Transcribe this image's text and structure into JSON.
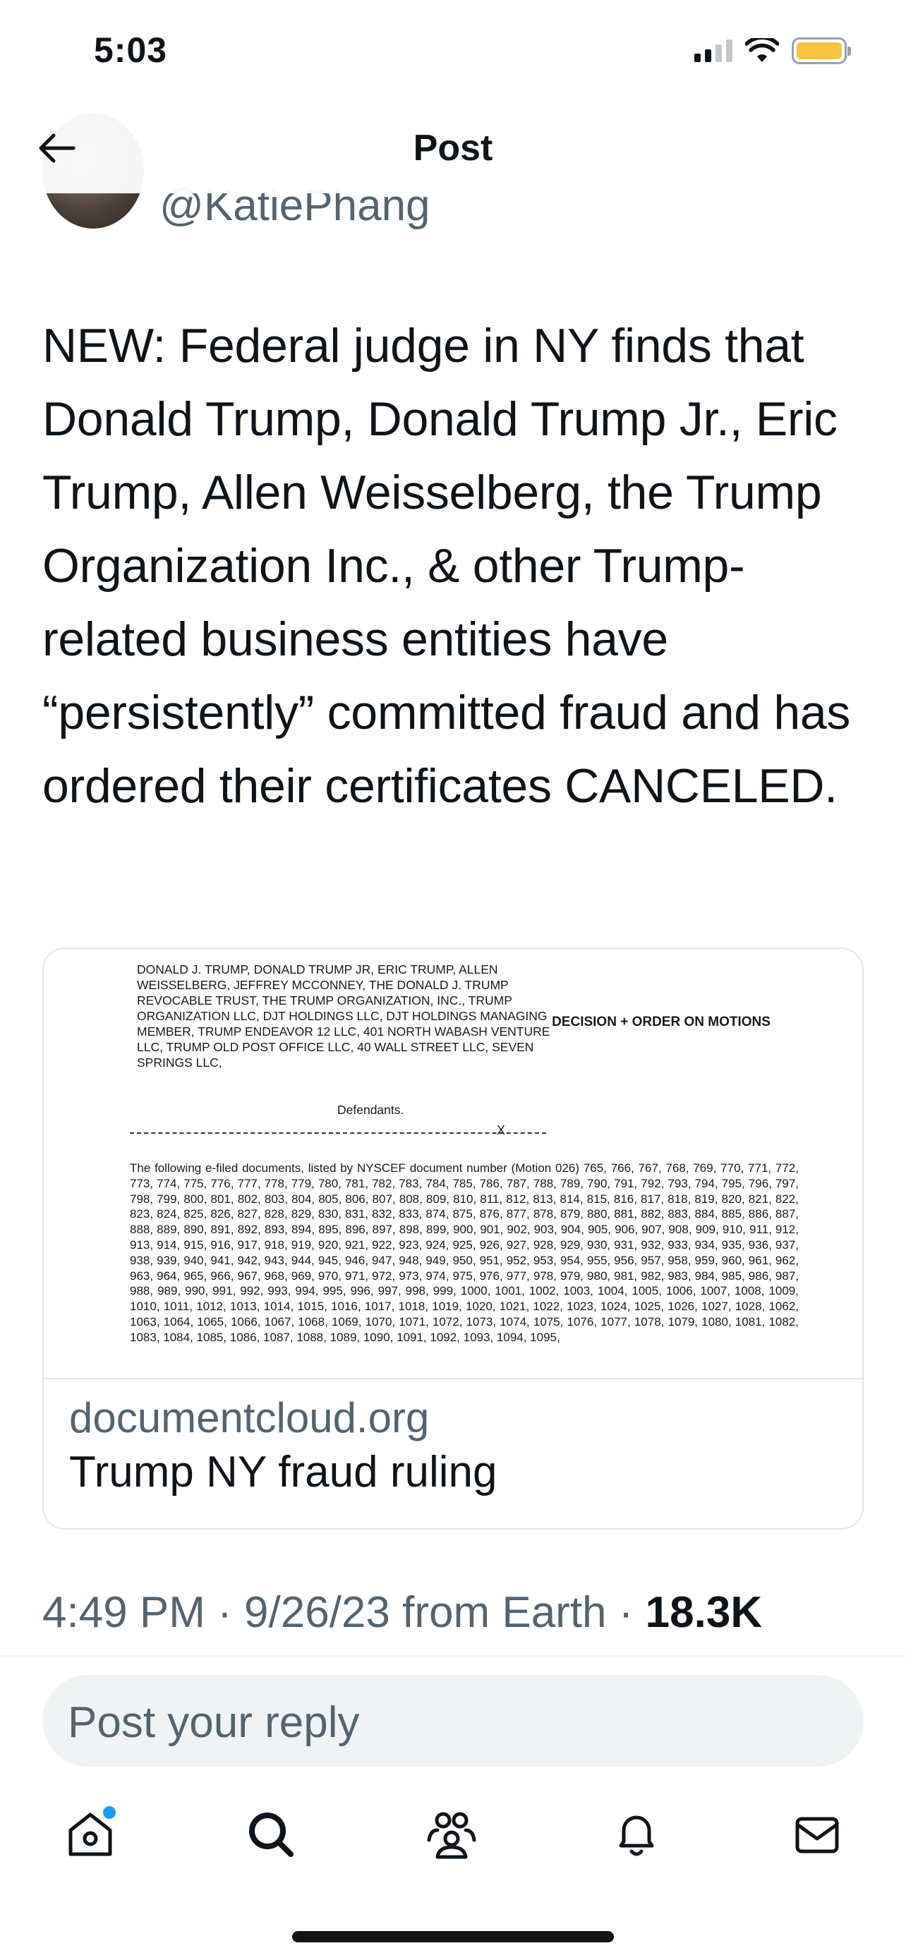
{
  "status_bar": {
    "time": "5:03"
  },
  "header": {
    "title": "Post"
  },
  "author": {
    "handle": "@KatiePhang"
  },
  "tweet": {
    "text": "NEW: Federal judge in NY finds that Donald Trump, Donald Trump Jr., Eric Trump, Allen Weisselberg, the Trump Organization Inc., & other Trump-related business entities have “persistently” committed fraud and has ordered their certificates CANCELED."
  },
  "card": {
    "document": {
      "parties": "DONALD J. TRUMP, DONALD TRUMP JR, ERIC TRUMP, ALLEN WEISSELBERG, JEFFREY MCCONNEY, THE DONALD J. TRUMP REVOCABLE TRUST, THE TRUMP ORGANIZATION, INC., TRUMP ORGANIZATION LLC, DJT HOLDINGS LLC, DJT HOLDINGS MANAGING MEMBER, TRUMP ENDEAVOR 12 LLC, 401 NORTH WABASH VENTURE LLC, TRUMP OLD POST OFFICE LLC, 40 WALL STREET LLC, SEVEN SPRINGS LLC,",
      "defendants": "Defendants.",
      "decision": "DECISION + ORDER ON MOTIONS",
      "rule_end": "X",
      "body": "The following e-filed documents, listed by NYSCEF document number (Motion 026) 765, 766, 767, 768, 769, 770, 771, 772, 773, 774, 775, 776, 777, 778, 779, 780, 781, 782, 783, 784, 785, 786, 787, 788, 789, 790, 791, 792, 793, 794, 795, 796, 797, 798, 799, 800, 801, 802, 803, 804, 805, 806, 807, 808, 809, 810, 811, 812, 813, 814, 815, 816, 817, 818, 819, 820, 821, 822, 823, 824, 825, 826, 827, 828, 829, 830, 831, 832, 833, 874, 875, 876, 877, 878, 879, 880, 881, 882, 883, 884, 885, 886, 887, 888, 889, 890, 891, 892, 893, 894, 895, 896, 897, 898, 899, 900, 901, 902, 903, 904, 905, 906, 907, 908, 909, 910, 911, 912, 913, 914, 915, 916, 917, 918, 919, 920, 921, 922, 923, 924, 925, 926, 927, 928, 929, 930, 931, 932, 933, 934, 935, 936, 937, 938, 939, 940, 941, 942, 943, 944, 945, 946, 947, 948, 949, 950, 951, 952, 953, 954, 955, 956, 957, 958, 959, 960, 961, 962, 963, 964, 965, 966, 967, 968, 969, 970, 971, 972, 973, 974, 975, 976, 977, 978, 979, 980, 981, 982, 983, 984, 985, 986, 987, 988, 989, 990, 991, 992, 993, 994, 995, 996, 997, 998, 999, 1000, 1001, 1002, 1003, 1004, 1005, 1006, 1007, 1008, 1009, 1010, 1011, 1012, 1013, 1014, 1015, 1016, 1017, 1018, 1019, 1020, 1021, 1022, 1023, 1024, 1025, 1026, 1027, 1028, 1062, 1063, 1064, 1065, 1066, 1067, 1068, 1069, 1070, 1071, 1072, 1073, 1074, 1075, 1076, 1077, 1078, 1079, 1080, 1081, 1082, 1083, 1084, 1085, 1086, 1087, 1088, 1089, 1090, 1091, 1092, 1093, 1094, 1095,"
    },
    "domain": "documentcloud.org",
    "title": "Trump NY fraud ruling"
  },
  "meta": {
    "time": "4:49 PM",
    "separator": "·",
    "date": "9/26/23",
    "source": "from Earth",
    "views": "18.3K"
  },
  "reply": {
    "placeholder": "Post your reply"
  },
  "tab_bar": {
    "items": [
      "home-icon",
      "search-icon",
      "communities-icon",
      "notifications-icon",
      "messages-icon"
    ],
    "accent_color": "#1d9bf0"
  }
}
